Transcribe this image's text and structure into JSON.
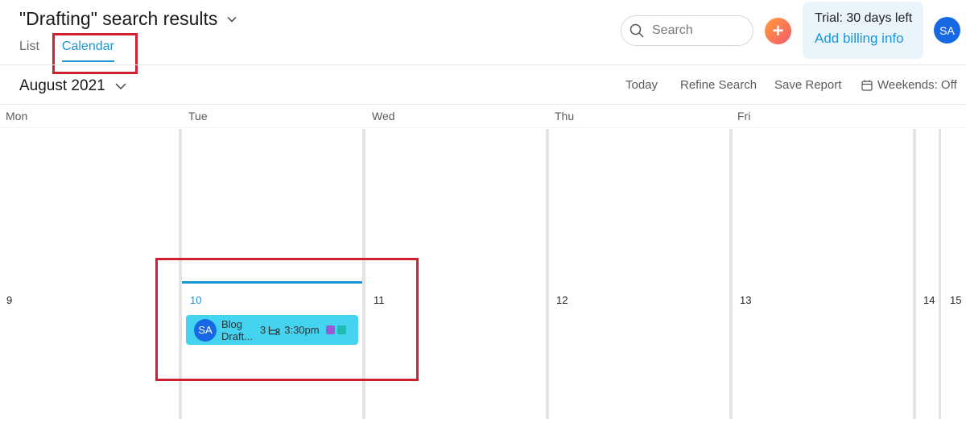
{
  "header": {
    "title": "\"Drafting\" search results",
    "tabs": [
      {
        "label": "List",
        "active": false
      },
      {
        "label": "Calendar",
        "active": true
      }
    ]
  },
  "search": {
    "placeholder": "Search"
  },
  "trial": {
    "status": "Trial: 30 days left",
    "link": "Add billing info"
  },
  "user": {
    "initials": "SA"
  },
  "toolbar": {
    "month": "August 2021",
    "today": "Today",
    "refine": "Refine Search",
    "save_report": "Save Report",
    "weekends": "Weekends: Off"
  },
  "calendar": {
    "days": [
      "Mon",
      "Tue",
      "Wed",
      "Thu",
      "Fri"
    ],
    "dates": [
      "9",
      "10",
      "11",
      "12",
      "13",
      "14",
      "15"
    ],
    "today_date": "10",
    "event": {
      "initials": "SA",
      "title": "Blog Draft...",
      "count": "3",
      "time": "3:30pm",
      "tag_colors": [
        "#9b59d6",
        "#1fbcb0"
      ]
    }
  },
  "colors": {
    "accent": "#1b95d4",
    "event_bg": "#45d3f2",
    "avatar": "#1668e3",
    "highlight_box": "#d0202f"
  }
}
